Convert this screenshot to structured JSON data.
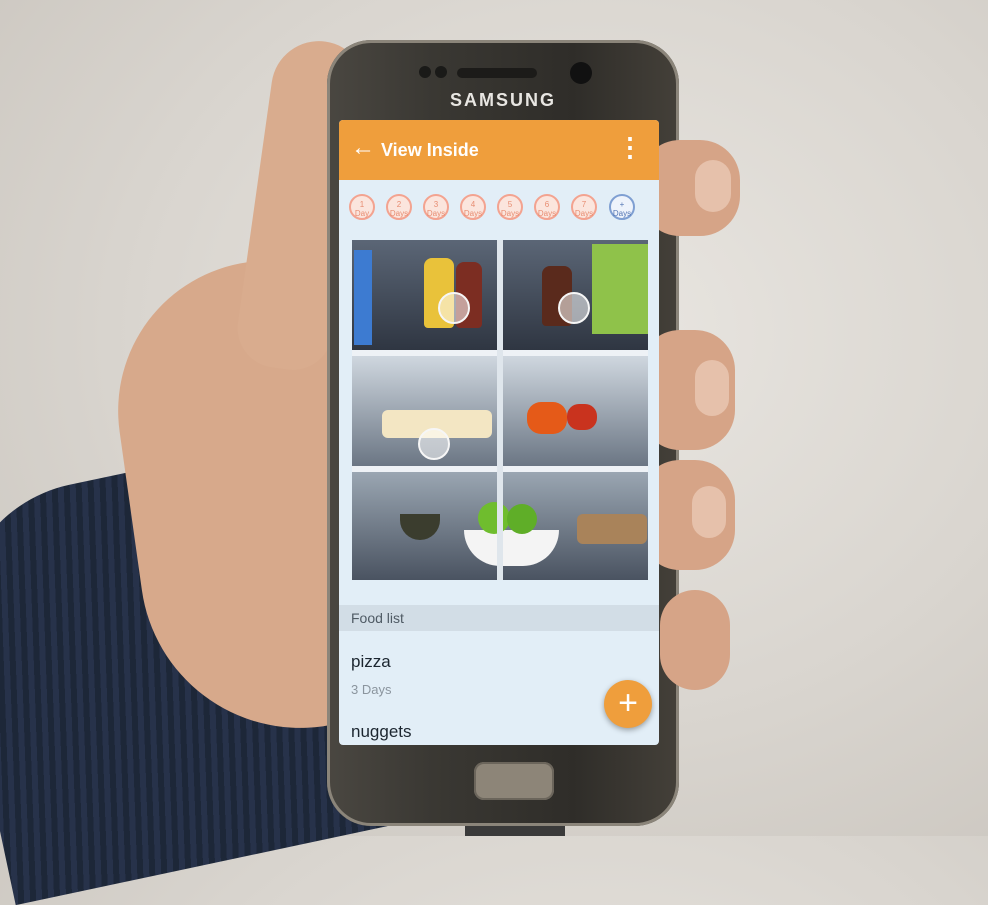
{
  "device": {
    "brand": "SAMSUNG"
  },
  "appbar": {
    "back_icon": "arrow-left-icon",
    "title": "View Inside",
    "menu_icon": "more-vertical-icon",
    "color": "#ef9e3c"
  },
  "day_filters": [
    {
      "num": "1",
      "unit": "Day"
    },
    {
      "num": "2",
      "unit": "Days"
    },
    {
      "num": "3",
      "unit": "Days"
    },
    {
      "num": "4",
      "unit": "Days"
    },
    {
      "num": "5",
      "unit": "Days"
    },
    {
      "num": "6",
      "unit": "Days"
    },
    {
      "num": "7",
      "unit": "Days"
    },
    {
      "num": "+",
      "unit": "Days"
    }
  ],
  "food_list": {
    "header": "Food list",
    "items": [
      {
        "name": "pizza",
        "sub": "3 Days"
      },
      {
        "name": "nuggets",
        "sub": ""
      }
    ]
  },
  "fab": {
    "label": "+",
    "icon": "plus-icon"
  }
}
